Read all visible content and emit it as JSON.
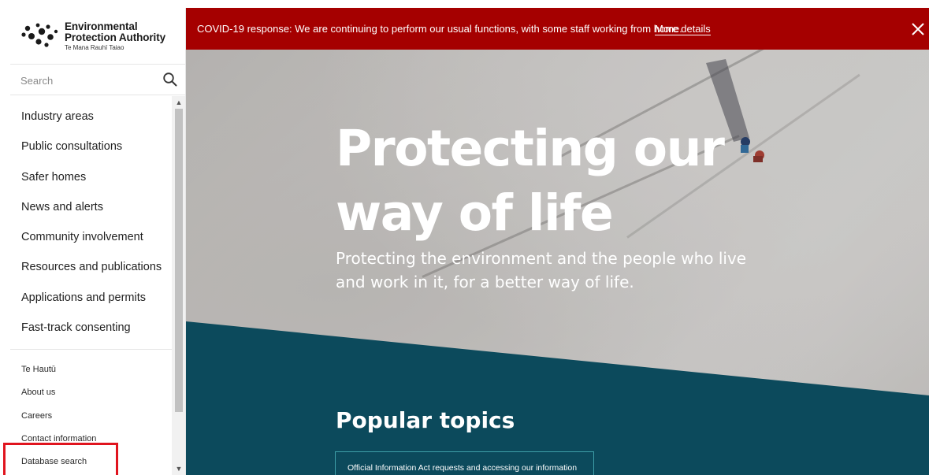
{
  "logo": {
    "line1": "Environmental",
    "line2": "Protection Authority",
    "subtitle": "Te Mana Rauhī Taiao"
  },
  "search": {
    "placeholder": "Search",
    "icon": "search-icon"
  },
  "sidebar": {
    "main_items": [
      {
        "label": "Industry areas"
      },
      {
        "label": "Public consultations"
      },
      {
        "label": "Safer homes"
      },
      {
        "label": "News and alerts"
      },
      {
        "label": "Community involvement"
      },
      {
        "label": "Resources and publications"
      },
      {
        "label": "Applications and permits"
      },
      {
        "label": "Fast-track consenting"
      }
    ],
    "secondary_items": [
      {
        "label": "Te Hautū"
      },
      {
        "label": "About us"
      },
      {
        "label": "Careers"
      },
      {
        "label": "Contact information"
      },
      {
        "label": "Database search"
      }
    ],
    "scroll_up_icon": "▲",
    "scroll_down_icon": "▼"
  },
  "banner": {
    "text": "COVID-19 response: We are continuing to perform our usual functions, with some staff working from home.",
    "link": "More details",
    "close_icon": "close-icon",
    "color": "#a50000"
  },
  "hero": {
    "title_line1": "Protecting our",
    "title_line2": "way of life",
    "subtitle_line1": "Protecting the environment and the people who live",
    "subtitle_line2": "and work in it, for a better way of life."
  },
  "popular": {
    "title": "Popular topics",
    "topics": [
      {
        "label": "Official Information Act requests and accessing our information"
      }
    ]
  },
  "colors": {
    "teal": "#0c4a5c",
    "highlight": "#e0141e"
  }
}
